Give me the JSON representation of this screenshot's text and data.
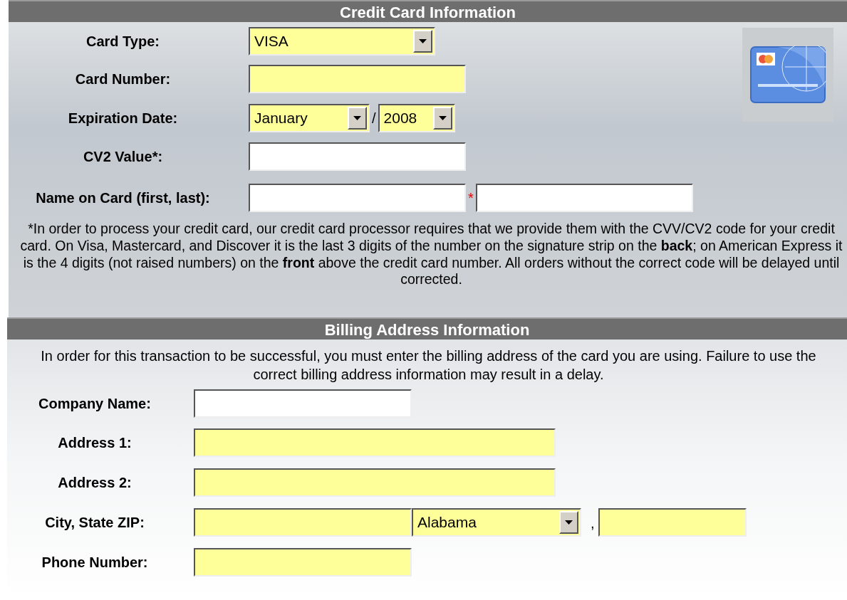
{
  "credit_card": {
    "title": "Credit Card Information",
    "rows": [
      {
        "label": "Card Type:",
        "inputs": [
          {
            "kind": "select",
            "value": "VISA",
            "required": true
          }
        ]
      },
      {
        "label": "Card Number:",
        "inputs": [
          {
            "kind": "text",
            "required": true
          }
        ]
      },
      {
        "label": "Expiration Date:",
        "inputs": [
          {
            "kind": "select",
            "value": "January",
            "required": true,
            "separator": "/"
          },
          {
            "kind": "select",
            "value": "2008",
            "required": true
          }
        ]
      },
      {
        "label": "CV2 Value*:",
        "inputs": [
          {
            "kind": "text",
            "required": false
          }
        ]
      },
      {
        "label": "Name on Card (first, last):",
        "inputs": [
          {
            "kind": "text",
            "required": false,
            "separator": "*"
          },
          {
            "kind": "text",
            "required": false
          }
        ]
      }
    ],
    "note": "*In order to process your credit card, our credit card processor requires that we provide them with the CVV/CV2 code for your credit card. On Visa, Mastercard, and Discover it is the last 3 digits of the number on the signature strip on the **back**; on American Express it is the 4 digits (not raised numbers) on the **front** above the credit card number. All orders without the correct code will be delayed until corrected."
  },
  "billing": {
    "title": "Billing Address Information",
    "intro": "In order for this transaction to be successful, you must enter the billing address of the card you are using. Failure to use the correct billing address information may result in a delay.",
    "rows": [
      {
        "label": "Company Name:",
        "inputs": [
          {
            "kind": "text",
            "required": false
          }
        ]
      },
      {
        "label": "Address 1:",
        "inputs": [
          {
            "kind": "text",
            "required": true
          }
        ]
      },
      {
        "label": "Address 2:",
        "inputs": [
          {
            "kind": "text",
            "required": true
          }
        ]
      },
      {
        "label": "City, State ZIP:",
        "inputs": [
          {
            "kind": "text",
            "required": true
          },
          {
            "kind": "select",
            "value": "Alabama",
            "required": true,
            "separator": ","
          },
          {
            "kind": "text",
            "required": true
          }
        ]
      },
      {
        "label": "Phone Number:",
        "inputs": [
          {
            "kind": "text",
            "required": true
          }
        ]
      }
    ]
  }
}
